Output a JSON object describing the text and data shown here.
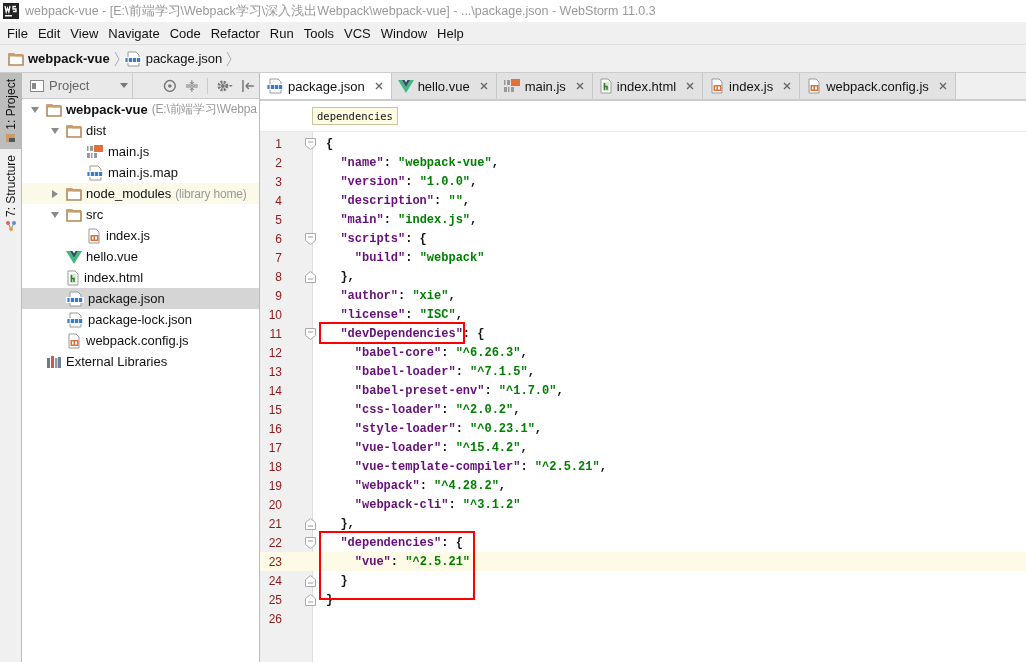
{
  "window": {
    "title": "webpack-vue - [E:\\前端学习\\Webpack学习\\深入浅出Webpack\\webpack-vue] - ...\\package.json - WebStorm 11.0.3"
  },
  "menu": [
    "File",
    "Edit",
    "View",
    "Navigate",
    "Code",
    "Refactor",
    "Run",
    "Tools",
    "VCS",
    "Window",
    "Help"
  ],
  "navigation_bar": [
    {
      "kind": "folder",
      "label": "webpack-vue"
    },
    {
      "kind": "json",
      "label": "package.json"
    }
  ],
  "tool_strip": [
    {
      "label": "1: Project",
      "selected": true,
      "kind": "project"
    },
    {
      "label": "7: Structure",
      "selected": false,
      "kind": "structure"
    }
  ],
  "project_panel": {
    "view": "Project",
    "tree": [
      {
        "kind": "folder",
        "label": "webpack-vue",
        "hint": "(E:\\前端学习\\Webpa",
        "expanded": true,
        "selected": false,
        "highlighted": false,
        "children": [
          {
            "kind": "folder",
            "label": "dist",
            "expanded": true,
            "selected": false,
            "highlighted": false,
            "children": [
              {
                "kind": "jsbin",
                "label": "main.js",
                "selected": false,
                "highlighted": false
              },
              {
                "kind": "json",
                "label": "main.js.map",
                "selected": false,
                "highlighted": false
              }
            ]
          },
          {
            "kind": "folder",
            "label": "node_modules",
            "hint": "(library home)",
            "expanded": false,
            "selected": false,
            "highlighted": true
          },
          {
            "kind": "folder",
            "label": "src",
            "expanded": true,
            "selected": false,
            "highlighted": false,
            "children": [
              {
                "kind": "js",
                "label": "index.js",
                "selected": false,
                "highlighted": false
              }
            ]
          },
          {
            "kind": "vue",
            "label": "hello.vue",
            "selected": false,
            "highlighted": false
          },
          {
            "kind": "html",
            "label": "index.html",
            "selected": false,
            "highlighted": false
          },
          {
            "kind": "json",
            "label": "package.json",
            "selected": true,
            "highlighted": false
          },
          {
            "kind": "json",
            "label": "package-lock.json",
            "selected": false,
            "highlighted": false
          },
          {
            "kind": "js",
            "label": "webpack.config.js",
            "selected": false,
            "highlighted": false
          }
        ]
      },
      {
        "kind": "libraries",
        "label": "External Libraries",
        "selected": false,
        "highlighted": false
      }
    ]
  },
  "editor_tabs": [
    {
      "kind": "json",
      "label": "package.json",
      "selected": true
    },
    {
      "kind": "vue",
      "label": "hello.vue",
      "selected": false
    },
    {
      "kind": "jsbin",
      "label": "main.js",
      "selected": false
    },
    {
      "kind": "html",
      "label": "index.html",
      "selected": false
    },
    {
      "kind": "js",
      "label": "index.js",
      "selected": false
    },
    {
      "kind": "js",
      "label": "webpack.config.js",
      "selected": false
    }
  ],
  "editor_breadcrumb": "dependencies",
  "code_lines": [
    {
      "number": "1",
      "text": "{",
      "fold_start": true,
      "fold_end": false
    },
    {
      "number": "2",
      "text": "  \"name\": \"webpack-vue\","
    },
    {
      "number": "3",
      "text": "  \"version\": \"1.0.0\","
    },
    {
      "number": "4",
      "text": "  \"description\": \"\","
    },
    {
      "number": "5",
      "text": "  \"main\": \"index.js\","
    },
    {
      "number": "6",
      "text": "  \"scripts\": {",
      "fold_start": true,
      "fold_end": false
    },
    {
      "number": "7",
      "text": "    \"build\": \"webpack\""
    },
    {
      "number": "8",
      "text": "  },",
      "fold_start": false,
      "fold_end": true
    },
    {
      "number": "9",
      "text": "  \"author\": \"xie\","
    },
    {
      "number": "10",
      "text": "  \"license\": \"ISC\","
    },
    {
      "number": "11",
      "text": "  \"devDependencies\": {",
      "fold_start": true,
      "fold_end": false,
      "boxed": true
    },
    {
      "number": "12",
      "text": "    \"babel-core\": \"^6.26.3\","
    },
    {
      "number": "13",
      "text": "    \"babel-loader\": \"^7.1.5\","
    },
    {
      "number": "14",
      "text": "    \"babel-preset-env\": \"^1.7.0\","
    },
    {
      "number": "15",
      "text": "    \"css-loader\": \"^2.0.2\","
    },
    {
      "number": "16",
      "text": "    \"style-loader\": \"^0.23.1\","
    },
    {
      "number": "17",
      "text": "    \"vue-loader\": \"^15.4.2\","
    },
    {
      "number": "18",
      "text": "    \"vue-template-compiler\": \"^2.5.21\","
    },
    {
      "number": "19",
      "text": "    \"webpack\": \"^4.28.2\","
    },
    {
      "number": "20",
      "text": "    \"webpack-cli\": \"^3.1.2\""
    },
    {
      "number": "21",
      "text": "  },",
      "fold_start": false,
      "fold_end": true
    },
    {
      "number": "22",
      "text": "  \"dependencies\": {",
      "fold_start": true,
      "fold_end": false,
      "boxed": true
    },
    {
      "number": "23",
      "text": "    \"vue\": \"^2.5.21\"",
      "current": true,
      "boxed": true
    },
    {
      "number": "24",
      "text": "  }",
      "fold_start": false,
      "fold_end": true,
      "boxed": true
    },
    {
      "number": "25",
      "text": "}",
      "fold_start": false,
      "fold_end": true
    },
    {
      "number": "26"
    }
  ]
}
